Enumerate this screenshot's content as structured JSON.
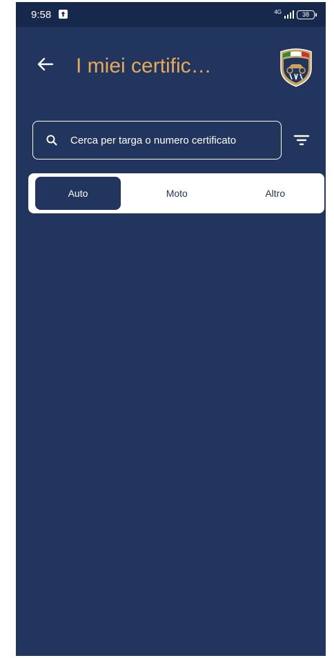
{
  "status_bar": {
    "time": "9:58",
    "network": "4G",
    "battery": "38"
  },
  "header": {
    "title": "I miei certific…",
    "back_icon": "arrow-left-icon",
    "logo_icon": "asi-logo-icon"
  },
  "search": {
    "placeholder": "Cerca per targa o numero certificato",
    "value": "",
    "icon": "search-icon",
    "filter_icon": "filter-icon"
  },
  "tabs": [
    {
      "label": "Auto",
      "active": true
    },
    {
      "label": "Moto",
      "active": false
    },
    {
      "label": "Altro",
      "active": false
    }
  ],
  "colors": {
    "background": "#22355f",
    "status_bar": "#17284d",
    "accent_title": "#e7aa55",
    "surface": "#ffffff"
  }
}
